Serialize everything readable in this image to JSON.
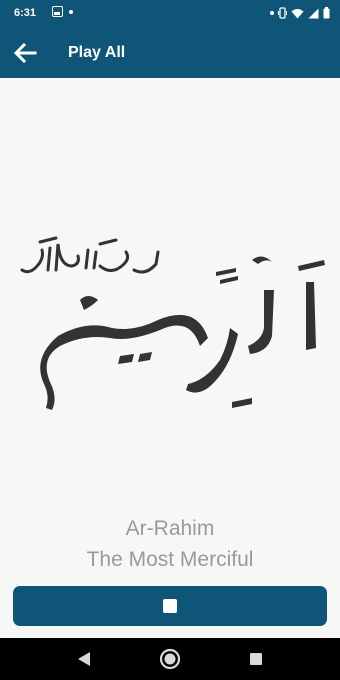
{
  "status_bar": {
    "time": "6:31",
    "icons": [
      "gallery-icon",
      "dot-icon",
      "dot-icon",
      "vibrate-icon",
      "wifi-icon",
      "signal-icon",
      "battery-icon"
    ]
  },
  "app_bar": {
    "title": "Play All",
    "back_icon": "arrow-back-icon"
  },
  "name": {
    "transliteration": "Ar-Rahim",
    "meaning": "The Most Merciful",
    "calligraphy_arabic": "الرحيم",
    "calligraphy_honorific": "جل جلاله"
  },
  "controls": {
    "stop_icon": "stop-icon"
  },
  "navigation": {
    "icons": [
      "back-triangle-icon",
      "home-circle-icon",
      "recents-square-icon"
    ]
  },
  "colors": {
    "primary": "#0f5577",
    "background": "#f7f7f7",
    "name_text": "#9a9a9a",
    "calligraphy": "#333333"
  }
}
